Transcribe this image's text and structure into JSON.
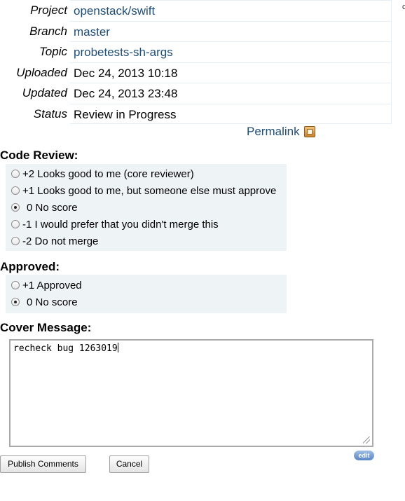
{
  "change_info": {
    "project": {
      "label": "Project",
      "value": "openstack/swift"
    },
    "branch": {
      "label": "Branch",
      "value": "master"
    },
    "topic": {
      "label": "Topic",
      "value": "probetests-sh-args"
    },
    "uploaded": {
      "label": "Uploaded",
      "value": "Dec 24, 2013 10:18"
    },
    "updated": {
      "label": "Updated",
      "value": "Dec 24, 2013 23:48"
    },
    "status": {
      "label": "Status",
      "value": "Review in Progress"
    }
  },
  "edge_glyph": "c",
  "permalink": {
    "label": "Permalink"
  },
  "code_review": {
    "title": "Code Review:",
    "options": [
      {
        "label": "+2 Looks good to me (core reviewer)",
        "checked": false
      },
      {
        "label": "+1 Looks good to me, but someone else must approve",
        "checked": false
      },
      {
        "label": "0 No score",
        "checked": true
      },
      {
        "label": "-1 I would prefer that you didn't merge this",
        "checked": false
      },
      {
        "label": "-2 Do not merge",
        "checked": false
      }
    ]
  },
  "approved": {
    "title": "Approved:",
    "options": [
      {
        "label": "+1 Approved",
        "checked": false
      },
      {
        "label": "0 No score",
        "checked": true
      }
    ]
  },
  "cover_message": {
    "title": "Cover Message:",
    "value": "recheck bug 1263019",
    "edit_label": "edit"
  },
  "buttons": {
    "publish": "Publish Comments",
    "cancel": "Cancel"
  }
}
